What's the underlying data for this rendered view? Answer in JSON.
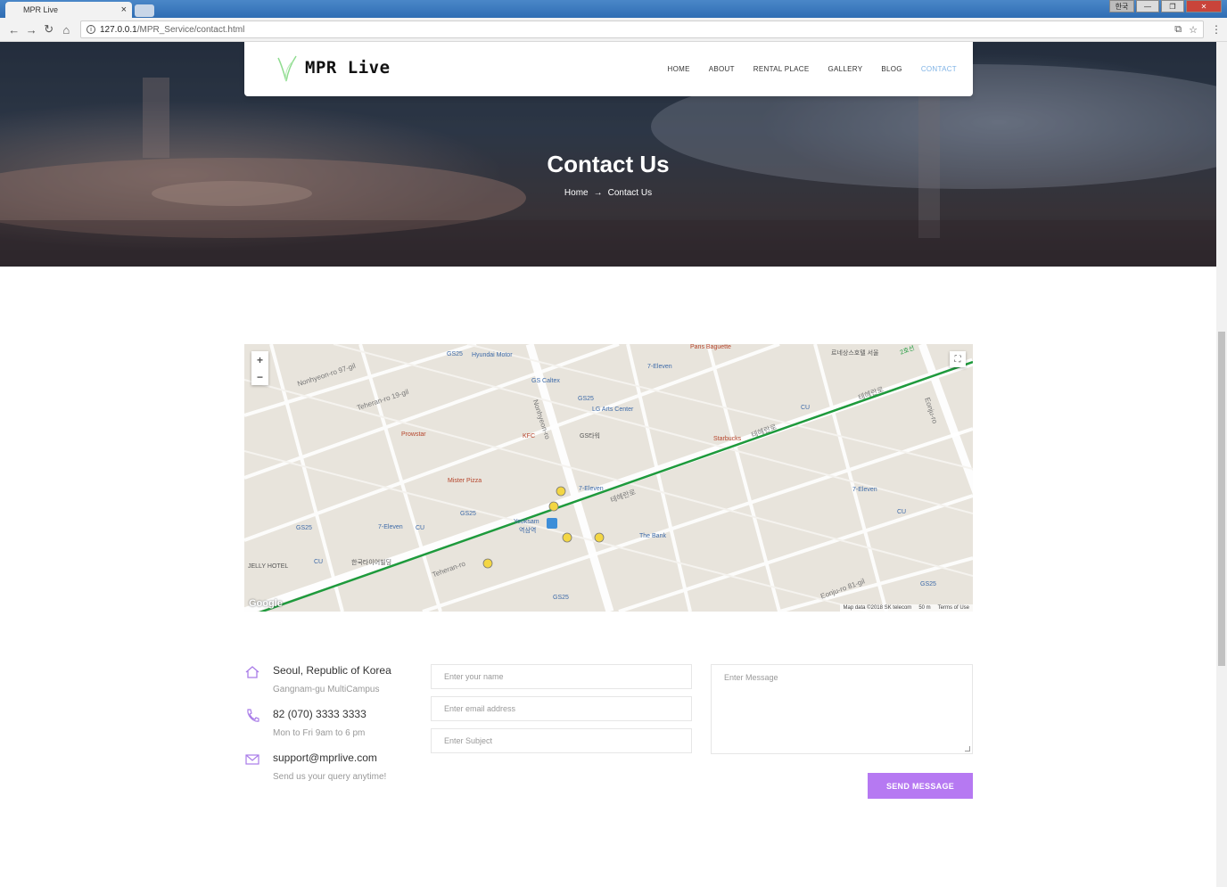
{
  "browser": {
    "tab_title": "MPR Live",
    "url_host": "127.0.0.1",
    "url_path": "/MPR_Service/contact.html",
    "lang_button": "한국"
  },
  "header": {
    "logo_text": "MPR Live",
    "nav": [
      {
        "label": "HOME"
      },
      {
        "label": "ABOUT"
      },
      {
        "label": "RENTAL PLACE"
      },
      {
        "label": "GALLERY"
      },
      {
        "label": "BLOG"
      },
      {
        "label": "CONTACT",
        "active": true
      }
    ]
  },
  "hero": {
    "title": "Contact Us",
    "breadcrumb_home": "Home",
    "breadcrumb_current": "Contact Us"
  },
  "map": {
    "labels": {
      "teheran_ro": "Teheran-ro",
      "teheran_ro_kr": "테헤란로",
      "nonhyeon_ro": "Nonhyeon-ro",
      "nonhyeon_ro_97": "Nonhyeon-ro 97-gil",
      "teheran_19": "Teheran-ro 19-gil",
      "eonju_ro": "Eonju-ro",
      "eonju_81": "Eonju-ro 81-gil",
      "yeoksam": "Yeoksam",
      "yeoksam_kr": "역삼역",
      "gs_caltex": "GS Caltex",
      "hyundai": "Hyundai Motor",
      "lg_arts": "LG Arts Center",
      "starbucks": "Starbucks",
      "kfc": "KFC",
      "prowstar": "Prowstar",
      "mister_pizza": "Mister Pizza",
      "the_bank": "The Bank",
      "seven_eleven": "7-Eleven",
      "gs25": "GS25",
      "cu": "CU",
      "jelly_hotel": "JELLY HOTEL",
      "paris": "Paris Baguette",
      "gs_tower": "GS타워",
      "line2": "2호선",
      "hanguk": "한국타이어빌딩",
      "lotte": "르네상스호텔 서울"
    },
    "zoom_in": "+",
    "zoom_out": "−",
    "google": "Google",
    "attribution": "Map data ©2018 SK telecom",
    "scale": "50 m",
    "terms": "Terms of Use"
  },
  "contact": {
    "address_main": "Seoul, Republic of Korea",
    "address_sub": "Gangnam-gu MultiCampus",
    "phone_main": "82 (070) 3333 3333",
    "phone_sub": "Mon to Fri 9am to 6 pm",
    "email_main": "support@mprlive.com",
    "email_sub": "Send us your query anytime!"
  },
  "form": {
    "name_placeholder": "Enter your name",
    "email_placeholder": "Enter email address",
    "subject_placeholder": "Enter Subject",
    "message_placeholder": "Enter Message",
    "send_label": "SEND MESSAGE"
  },
  "colors": {
    "accent": "#b679f2",
    "nav_active": "#7fb3e6",
    "icon": "#a97ce8"
  }
}
